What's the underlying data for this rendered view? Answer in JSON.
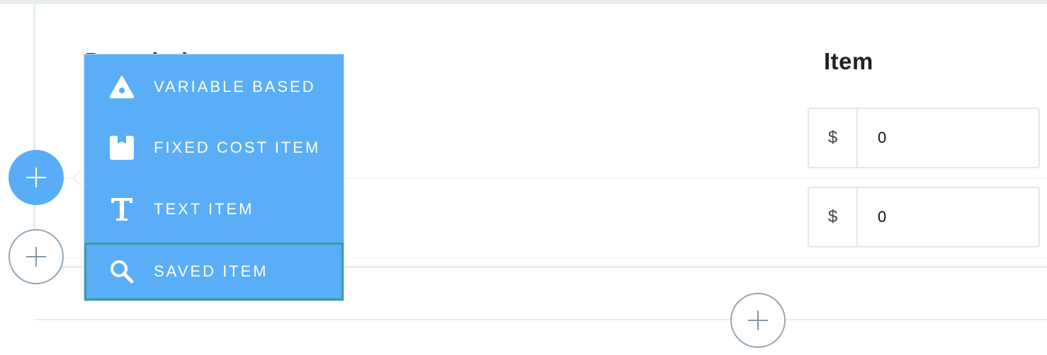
{
  "table": {
    "columns": [
      {
        "label": "Description"
      },
      {
        "label": "Item"
      }
    ],
    "rows": [
      {
        "currency": "$",
        "value": "0"
      },
      {
        "currency": "$",
        "value": "0"
      }
    ]
  },
  "add_menu": {
    "items": [
      {
        "label": "VARIABLE BASED",
        "icon": "variable-triangle-icon"
      },
      {
        "label": "FIXED COST ITEM",
        "icon": "fixed-cost-box-icon"
      },
      {
        "label": "TEXT ITEM",
        "icon": "text-t-icon"
      },
      {
        "label": "SAVED ITEM",
        "icon": "search-icon"
      }
    ],
    "highlighted_item": "SAVED ITEM"
  },
  "colors": {
    "menu_bg": "#5aaef8",
    "active_button": "#59adf7",
    "focus_outline": "#3f9aa0",
    "outline_button": "#93a6b5"
  }
}
